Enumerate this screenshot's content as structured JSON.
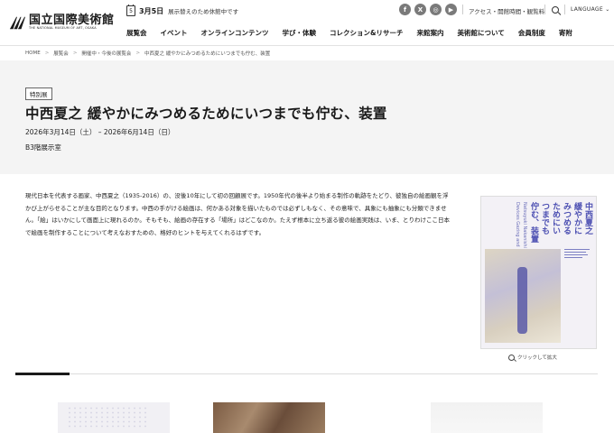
{
  "header": {
    "logo_jp": "国立国際美術館",
    "logo_en": "THE NATIONAL MUSEUM OF ART, OSAKA",
    "notice_day": "5",
    "notice_date": "3月5日",
    "notice_text": "展示替えのため休館中です",
    "social": [
      "f",
      "X",
      "◎",
      "▶"
    ],
    "access_link": "アクセス・開館時間・観覧料",
    "language_label": "LANGUAGE",
    "language_arrow": "⌄"
  },
  "nav": {
    "items": [
      "展覧会",
      "イベント",
      "オンラインコンテンツ",
      "学び・体験",
      "コレクション&リサーチ",
      "来館案内",
      "美術館について",
      "会員制度",
      "寄附"
    ]
  },
  "breadcrumb": {
    "items": [
      "HOME",
      "展覧会",
      "開催中・今後の展覧会",
      "中西夏之 緩やかにみつめるためにいつまでも佇む、装置"
    ],
    "separator": ">"
  },
  "exhibition": {
    "tag": "特別展",
    "title": "中西夏之 緩やかにみつめるためにいつまでも佇む、装置",
    "date": "2026年3月14日（土） – 2026年6月14日（日）",
    "venue": "B3階展示室",
    "description": "現代日本を代表する画家、中西夏之（1935-2016）の、没後10年にして初の回顧展です。1950年代の後半より始まる制作の軌跡をたどり、彼独自の絵画観を浮かび上がらせることが主な目的となります。中西の手がける絵画は、何かある対象を描いたものでは必ずしもなく、その意味で、具象にも抽象にも分類できません。「絵」はいかにして画面上に現れるのか。そもそも、絵画の存在する「場所」はどこなのか。たえず根本に立ち返る彼の絵画実践は、いま、とりわけここ日本で絵画を制作することについて考えなおすための、格好のヒントを与えてくれるはずです。"
  },
  "poster": {
    "lines": [
      "中西夏之",
      "緩やかに",
      "みつめる",
      "ためにい",
      "つまでも",
      "佇む、装置"
    ],
    "sub_lines": [
      "Natsuyuki Nakanishi",
      "Devices Gazing and"
    ],
    "zoom_label": "クリックして拡大"
  }
}
